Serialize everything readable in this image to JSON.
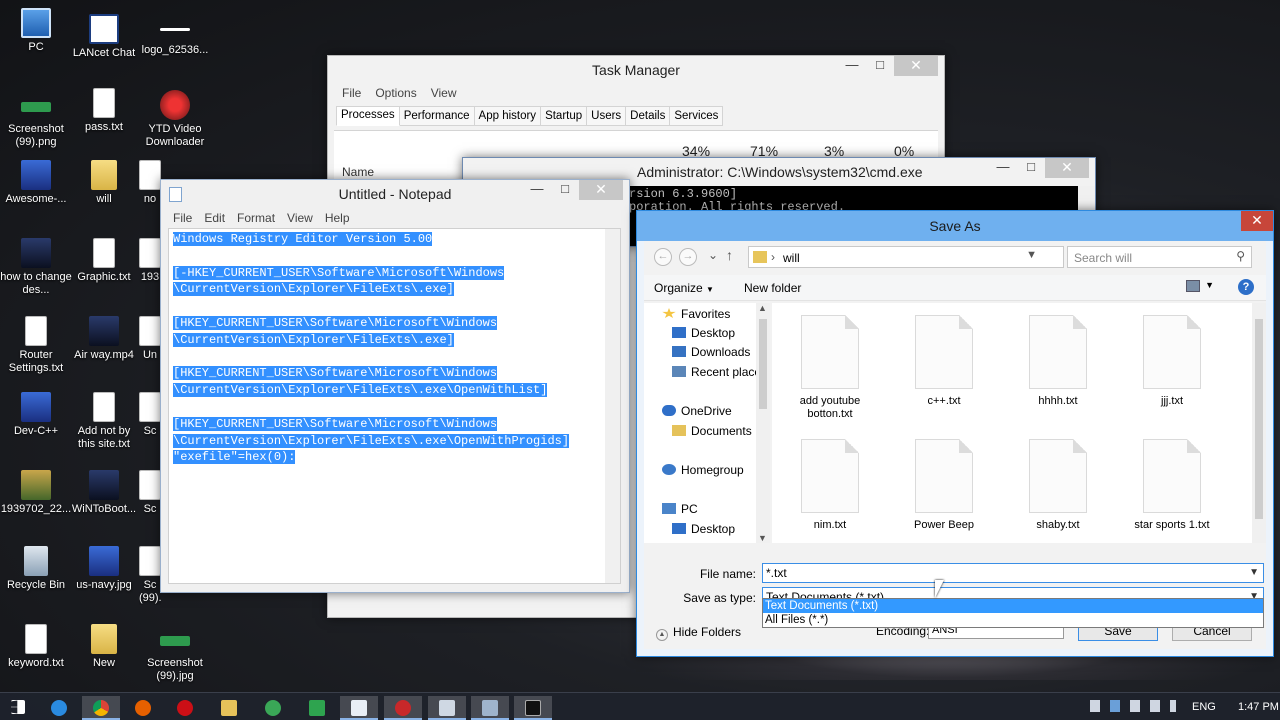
{
  "desktop": {
    "icons": [
      {
        "label": "PC",
        "icon": "pc-icon"
      },
      {
        "label": "LANcet Chat",
        "icon": "chat-icon"
      },
      {
        "label": "logo_62536...",
        "icon": "image-icon"
      },
      {
        "label": "Screenshot (99).png",
        "icon": "image-icon"
      },
      {
        "label": "pass.txt",
        "icon": "text-file-icon"
      },
      {
        "label": "YTD Video Downloader",
        "icon": "ytd-icon"
      },
      {
        "label": "Awesome-...",
        "icon": "app-icon"
      },
      {
        "label": "will",
        "icon": "folder-icon"
      },
      {
        "label": "how to change des...",
        "icon": "video-icon"
      },
      {
        "label": "Graphic.txt",
        "icon": "text-file-icon"
      },
      {
        "label": "Router Settings.txt",
        "icon": "text-file-icon"
      },
      {
        "label": "Air way.mp4",
        "icon": "video-icon"
      },
      {
        "label": "Dev-C++",
        "icon": "devcpp-icon"
      },
      {
        "label": "Add not by this site.txt",
        "icon": "text-file-icon"
      },
      {
        "label": "1939702_22...",
        "icon": "image-icon"
      },
      {
        "label": "WiNToBoot...",
        "icon": "app-icon"
      },
      {
        "label": "Recycle Bin",
        "icon": "recycle-bin-icon"
      },
      {
        "label": "us-navy.jpg",
        "icon": "image-icon"
      },
      {
        "label": "keyword.txt",
        "icon": "text-file-icon"
      },
      {
        "label": "New",
        "icon": "folder-icon"
      },
      {
        "label": "Screenshot (99).jpg",
        "icon": "image-icon"
      }
    ],
    "partial_labels": [
      "no",
      "193",
      "Un",
      "Sc",
      "Sc",
      "Sc (99).png"
    ]
  },
  "taskmgr": {
    "title": "Task Manager",
    "menu": [
      "File",
      "Options",
      "View"
    ],
    "tabs": [
      "Processes",
      "Performance",
      "App history",
      "Startup",
      "Users",
      "Details",
      "Services"
    ],
    "active_tab": "Processes",
    "column_name": "Name",
    "percents": [
      "34%",
      "71%",
      "3%",
      "0%"
    ]
  },
  "cmd": {
    "title": "Administrator: C:\\Windows\\system32\\cmd.exe",
    "lines": [
      "rsion 6.3.9600]",
      "poration. All rights reserved."
    ]
  },
  "notepad": {
    "title": "Untitled - Notepad",
    "menu": [
      "File",
      "Edit",
      "Format",
      "View",
      "Help"
    ],
    "lines": [
      "Windows Registry Editor Version 5.00",
      "",
      "[-HKEY_CURRENT_USER\\Software\\Microsoft\\Windows",
      "\\CurrentVersion\\Explorer\\FileExts\\.exe]",
      "",
      "[HKEY_CURRENT_USER\\Software\\Microsoft\\Windows",
      "\\CurrentVersion\\Explorer\\FileExts\\.exe]",
      "",
      "[HKEY_CURRENT_USER\\Software\\Microsoft\\Windows",
      "\\CurrentVersion\\Explorer\\FileExts\\.exe\\OpenWithList]",
      "",
      "[HKEY_CURRENT_USER\\Software\\Microsoft\\Windows",
      "\\CurrentVersion\\Explorer\\FileExts\\.exe\\OpenWithProgids]",
      "\"exefile\"=hex(0):"
    ]
  },
  "saveas": {
    "title": "Save As",
    "address": "will",
    "search_placeholder": "Search will",
    "organize": "Organize",
    "new_folder": "New folder",
    "tree": [
      {
        "label": "Favorites",
        "icon": "star-icon",
        "level": 0
      },
      {
        "label": "Desktop",
        "icon": "desktop-icon",
        "level": 1
      },
      {
        "label": "Downloads",
        "icon": "downloads-icon",
        "level": 1
      },
      {
        "label": "Recent places",
        "icon": "recent-places-icon",
        "level": 1
      },
      {
        "label": "OneDrive",
        "icon": "onedrive-icon",
        "level": 0
      },
      {
        "label": "Documents",
        "icon": "folder-icon",
        "level": 1
      },
      {
        "label": "Homegroup",
        "icon": "homegroup-icon",
        "level": 0
      },
      {
        "label": "PC",
        "icon": "pc-icon",
        "level": 0
      },
      {
        "label": "Desktop",
        "icon": "desktop-icon",
        "level": 1
      }
    ],
    "files": [
      "add youtube botton.txt",
      "c++.txt",
      "hhhh.txt",
      "jjj.txt",
      "nim.txt",
      "Power Beep",
      "shaby.txt",
      "star sports 1.txt"
    ],
    "file_name_label": "File name:",
    "file_name_value": "*.txt",
    "save_type_label": "Save as type:",
    "save_type_value": "Text Documents (*.txt)",
    "type_options": [
      "Text Documents (*.txt)",
      "All Files  (*.*)"
    ],
    "hide_folders": "Hide Folders",
    "encoding_label": "Encoding:",
    "encoding_value": "ANSI",
    "save_button": "Save",
    "cancel_button": "Cancel"
  },
  "taskbar": {
    "language": "ENG",
    "time": "1:47 PM"
  }
}
